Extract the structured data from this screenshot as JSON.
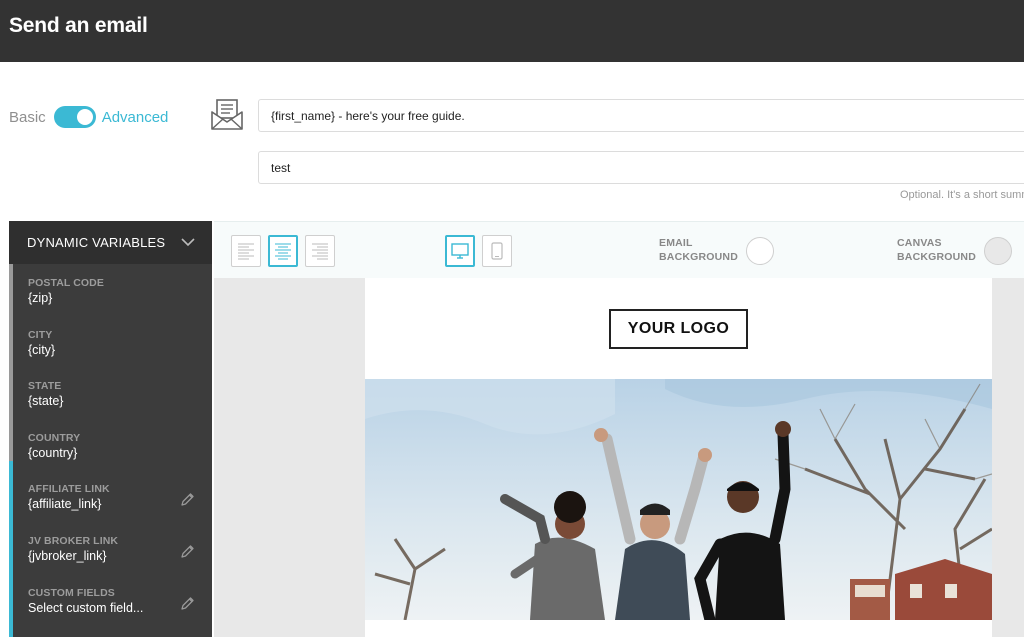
{
  "header": {
    "title": "Send an email"
  },
  "mode": {
    "basic_label": "Basic",
    "advanced_label": "Advanced",
    "advanced_on": true
  },
  "subject": {
    "value": "{first_name} - here's your free guide."
  },
  "preview": {
    "value": "test",
    "hint": "Optional. It's a short summ"
  },
  "sidebar": {
    "title": "DYNAMIC VARIABLES",
    "items": [
      {
        "label": "POSTAL CODE",
        "value": "{zip}"
      },
      {
        "label": "CITY",
        "value": "{city}"
      },
      {
        "label": "STATE",
        "value": "{state}"
      },
      {
        "label": "COUNTRY",
        "value": "{country}"
      },
      {
        "label": "AFFILIATE LINK",
        "value": "{affiliate_link}",
        "editable": true
      },
      {
        "label": "JV BROKER LINK",
        "value": "{jvbroker_link}",
        "editable": true
      },
      {
        "label": "CUSTOM FIELDS",
        "value": "Select custom field...",
        "editable": true
      }
    ]
  },
  "toolbar": {
    "email_bg_line1": "EMAIL",
    "email_bg_line2": "BACKGROUND",
    "canvas_bg_line1": "CANVAS",
    "canvas_bg_line2": "BACKGROUND",
    "email_bg_color": "#ffffff",
    "canvas_bg_color": "#e8e8e8"
  },
  "email": {
    "logo_text": "YOUR LOGO"
  },
  "colors": {
    "accent": "#3bb9d4",
    "header_bg": "#333333",
    "sidebar_bg": "#3c3c3c"
  }
}
